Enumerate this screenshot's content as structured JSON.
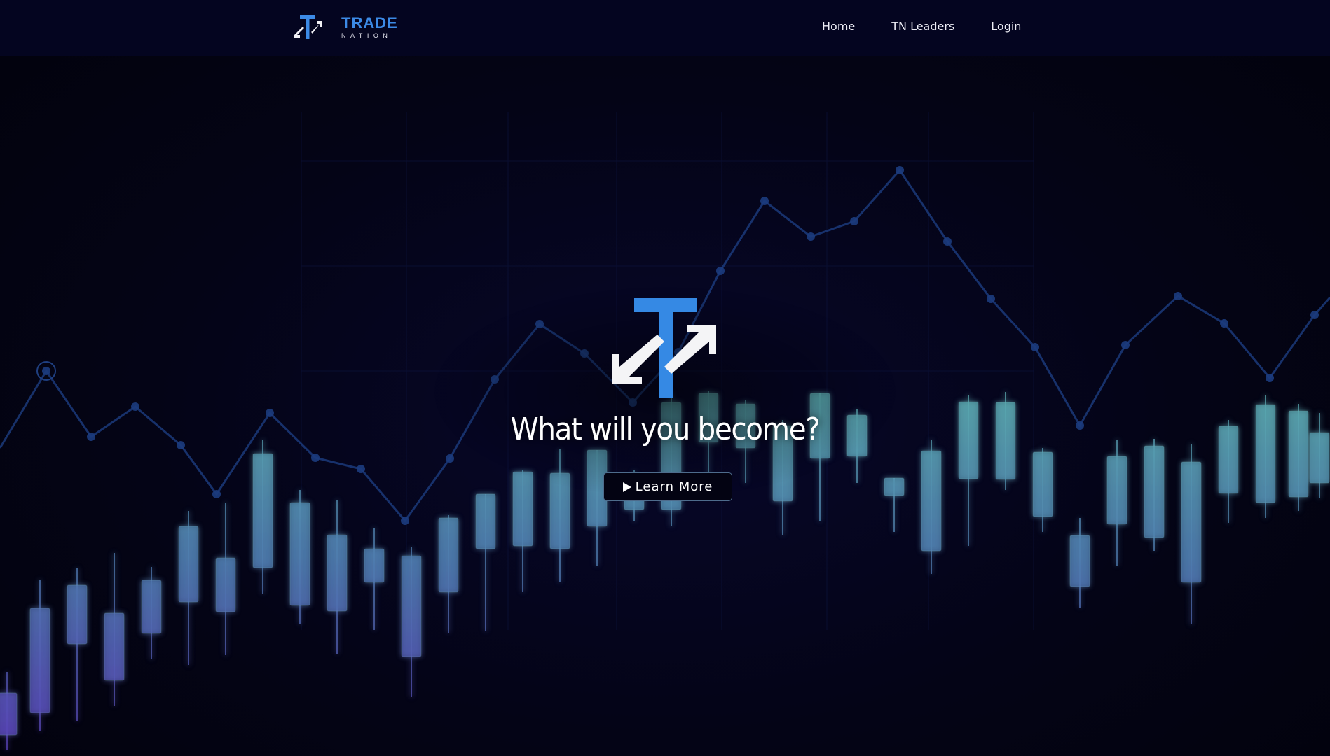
{
  "brand": {
    "name_line1": "TRADE",
    "name_line2": "NATION",
    "logo_icon": "trade-nation-logo-icon",
    "accent_color": "#3c8ae6"
  },
  "nav": {
    "links": [
      {
        "label": "Home"
      },
      {
        "label": "TN Leaders"
      },
      {
        "label": "Login"
      }
    ]
  },
  "hero": {
    "heading": "What will you become?",
    "button_label": "Learn More",
    "button_icon": "play-icon",
    "logo_icon": "trade-nation-hero-logo-icon"
  },
  "background": {
    "line_color": "#1b3a7a",
    "candle_color_top": "#5fb8b0",
    "candle_color_bottom": "#5a4cb5"
  }
}
